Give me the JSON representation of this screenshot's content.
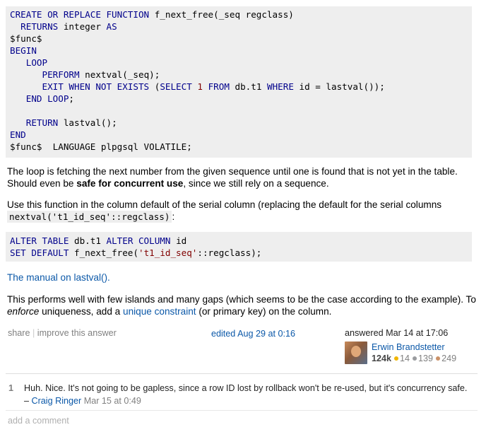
{
  "code_block_1": {
    "lines": [
      [
        "CREATE OR REPLACE FUNCTION",
        " f_next_free(_seq regclass)"
      ],
      [
        "  RETURNS",
        " integer ",
        "AS"
      ],
      [
        "$func$"
      ],
      [
        "BEGIN"
      ],
      [
        "   LOOP"
      ],
      [
        "      PERFORM",
        " nextval(_seq);"
      ],
      [
        "      EXIT WHEN NOT EXISTS",
        " (",
        "SELECT",
        " ",
        "1",
        " ",
        "FROM",
        " db.t1 ",
        "WHERE",
        " id = lastval());"
      ],
      [
        "   END LOOP",
        ";"
      ],
      [
        ""
      ],
      [
        "   RETURN",
        " lastval();"
      ],
      [
        "END"
      ],
      [
        "$func$  LANGUAGE plpgsql VOLATILE;"
      ]
    ]
  },
  "para_1": {
    "text_a": "The loop is fetching the next number from the given sequence until one is found that is not yet in the table. Should even be ",
    "bold": "safe for concurrent use",
    "text_b": ", since we still rely on a sequence."
  },
  "para_2": {
    "text_a": "Use this function in the column default of the serial column (replacing the default for the serial columns ",
    "code": "nextval('t1_id_seq'::regclass)",
    "text_b": ":"
  },
  "code_block_2": {
    "l1_kw": "ALTER TABLE",
    "l1_a": " db.t1 ",
    "l1_kw2": "ALTER COLUMN",
    "l1_b": " id",
    "l2_kw": "SET DEFAULT",
    "l2_a": " f_next_free(",
    "l2_str": "'t1_id_seq'",
    "l2_b": "::regclass);"
  },
  "manual_link": "The manual on lastval().",
  "para_3": {
    "text_a": "This performs well with few islands and many gaps (which seems to be the case according to the example). To ",
    "em": "enforce",
    "text_b": " uniqueness, add a ",
    "link": "unique constraint",
    "text_c": " (or primary key) on the column."
  },
  "post_menu": {
    "share": "share",
    "sep": "|",
    "improve": "improve this answer"
  },
  "edited": "edited Aug 29 at 0:16",
  "signature": {
    "answered": "answered Mar 14 at 17:06",
    "user": "Erwin Brandstetter",
    "reputation": "124k",
    "gold": "14",
    "silver": "139",
    "bronze": "249",
    "gold_color": "#f1b600",
    "silver_color": "#9a9c9f",
    "bronze_color": "#cb9168"
  },
  "comment": {
    "score": "1",
    "text": "Huh. Nice. It's not going to be gapless, since a row ID lost by rollback won't be re-used, but it's concurrency safe. –",
    "user": "Craig Ringer",
    "time": "Mar 15 at 0:49"
  },
  "add_comment": "add a comment"
}
